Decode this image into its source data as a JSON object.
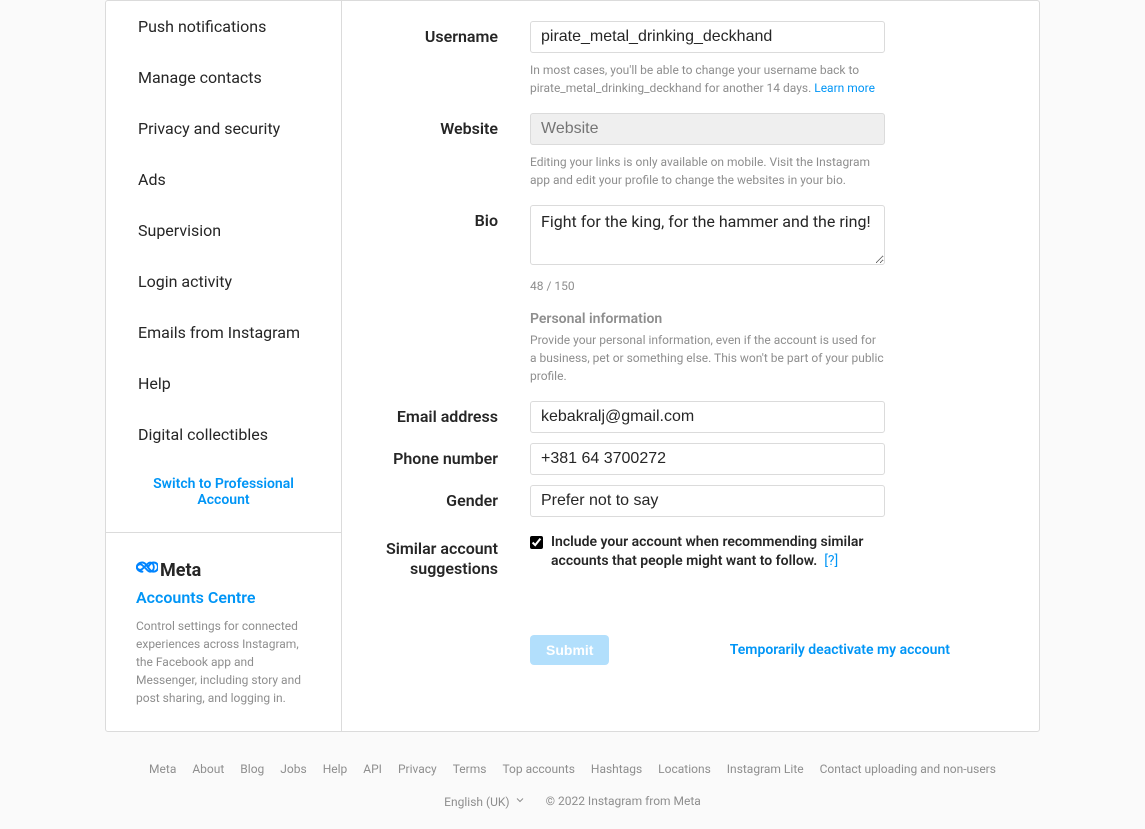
{
  "sidebar": {
    "items": [
      "Push notifications",
      "Manage contacts",
      "Privacy and security",
      "Ads",
      "Supervision",
      "Login activity",
      "Emails from Instagram",
      "Help",
      "Digital collectibles"
    ],
    "switch_professional": "Switch to Professional Account",
    "meta_brand": "Meta",
    "accounts_centre_link": "Accounts Centre",
    "accounts_centre_desc": "Control settings for connected experiences across Instagram, the Facebook app and Messenger, including story and post sharing, and logging in."
  },
  "form": {
    "username_label": "Username",
    "username_value": "pirate_metal_drinking_deckhand",
    "username_helper_prefix": "In most cases, you'll be able to change your username back to pirate_metal_drinking_deckhand for another 14 days. ",
    "username_helper_link": "Learn more",
    "website_label": "Website",
    "website_placeholder": "Website",
    "website_helper": "Editing your links is only available on mobile. Visit the Instagram app and edit your profile to change the websites in your bio.",
    "bio_label": "Bio",
    "bio_value": "Fight for the king, for the hammer and the ring!",
    "bio_counter": "48 / 150",
    "personal_heading": "Personal information",
    "personal_desc": "Provide your personal information, even if the account is used for a business, pet or something else. This won't be part of your public profile.",
    "email_label": "Email address",
    "email_value": "kebakralj@gmail.com",
    "phone_label": "Phone number",
    "phone_value": "+381 64 3700272",
    "gender_label": "Gender",
    "gender_value": "Prefer not to say",
    "similar_label": "Similar account suggestions",
    "similar_checkbox_label": "Include your account when recommending similar accounts that people might want to follow.",
    "similar_help": "[?]",
    "submit": "Submit",
    "deactivate": "Temporarily deactivate my account"
  },
  "footer": {
    "links": [
      "Meta",
      "About",
      "Blog",
      "Jobs",
      "Help",
      "API",
      "Privacy",
      "Terms",
      "Top accounts",
      "Hashtags",
      "Locations",
      "Instagram Lite",
      "Contact uploading and non-users"
    ],
    "language": "English (UK)",
    "copyright": "© 2022 Instagram from Meta"
  }
}
